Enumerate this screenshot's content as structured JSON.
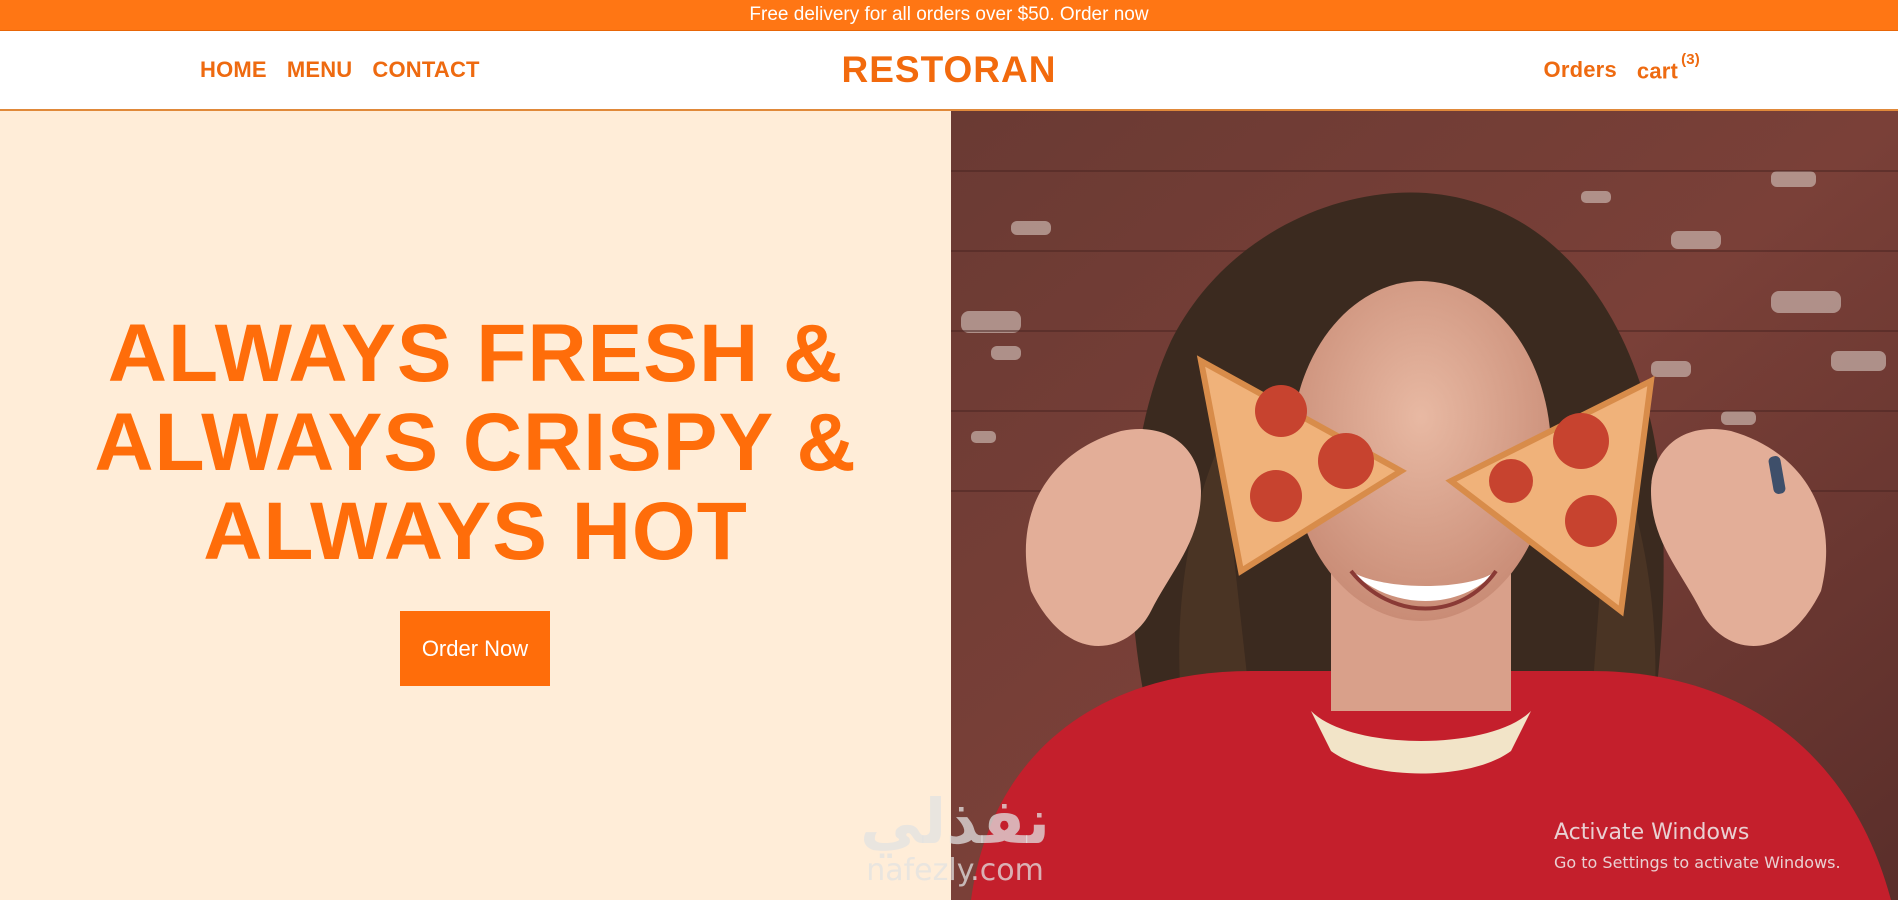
{
  "promo_bar": {
    "text": "Free delivery for all orders over $50. Order now"
  },
  "header": {
    "nav": [
      {
        "label": "HOME"
      },
      {
        "label": "MENU"
      },
      {
        "label": "CONTACT"
      }
    ],
    "brand": "RESTORAN",
    "orders_label": "Orders",
    "cart_label": "cart",
    "cart_count": "(3)"
  },
  "hero": {
    "headline_lines": [
      "ALWAYS FRESH &",
      "ALWAYS CRISPY &",
      "ALWAYS HOT"
    ],
    "cta_label": "Order Now"
  },
  "watermark": {
    "arabic": "نفذلي",
    "latin": "nafezly.com"
  },
  "os_notice": {
    "title": "Activate Windows",
    "subtitle": "Go to Settings to activate Windows."
  },
  "colors": {
    "accent": "#ff6d0a",
    "hero_bg": "#ffedd8",
    "promo_bg": "#ff7614"
  }
}
